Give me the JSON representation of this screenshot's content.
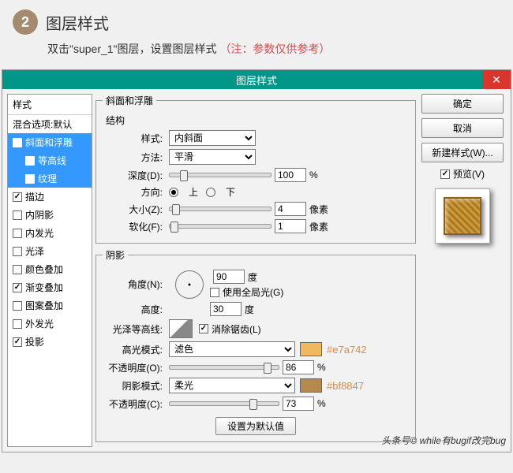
{
  "header": {
    "step": "2",
    "title": "图层样式",
    "desc_prefix": "双击\"super_1\"图层，设置图层样式",
    "note": "（注：参数仅供参考）"
  },
  "dialog": {
    "title": "图层样式"
  },
  "left": {
    "head": "样式",
    "blend": "混合选项:默认",
    "items": [
      {
        "label": "斜面和浮雕",
        "checked": true,
        "selected": true
      },
      {
        "label": "等高线",
        "checked": false,
        "sub": true,
        "selected": true
      },
      {
        "label": "纹理",
        "checked": true,
        "sub": true,
        "selected": true
      },
      {
        "label": "描边",
        "checked": true
      },
      {
        "label": "内阴影",
        "checked": false
      },
      {
        "label": "内发光",
        "checked": false
      },
      {
        "label": "光泽",
        "checked": false
      },
      {
        "label": "颜色叠加",
        "checked": false
      },
      {
        "label": "渐变叠加",
        "checked": true
      },
      {
        "label": "图案叠加",
        "checked": false
      },
      {
        "label": "外发光",
        "checked": false
      },
      {
        "label": "投影",
        "checked": true
      }
    ]
  },
  "bevel": {
    "group": "斜面和浮雕",
    "struct": "结构",
    "style_label": "样式:",
    "style_value": "内斜面",
    "tech_label": "方法:",
    "tech_value": "平滑",
    "depth_label": "深度(D):",
    "depth_value": "100",
    "pct": "%",
    "dir_label": "方向:",
    "up": "上",
    "down": "下",
    "size_label": "大小(Z):",
    "size_value": "4",
    "px": "像素",
    "soften_label": "软化(F):",
    "soften_value": "1"
  },
  "shade": {
    "group": "阴影",
    "angle_label": "角度(N):",
    "angle_value": "90",
    "deg": "度",
    "global": "使用全局光(G)",
    "alt_label": "高度:",
    "alt_value": "30",
    "gloss_label": "光泽等高线:",
    "aa": "消除锯齿(L)",
    "hi_label": "高光模式:",
    "hi_value": "滤色",
    "hi_hex": "#e7a742",
    "hi_color": "#f0b85f",
    "hi_op_label": "不透明度(O):",
    "hi_op_value": "86",
    "sh_label": "阴影模式:",
    "sh_value": "柔光",
    "sh_hex": "#bf8847",
    "sh_color": "#b5894e",
    "sh_op_label": "不透明度(C):",
    "sh_op_value": "73"
  },
  "buttons": {
    "ok": "确定",
    "cancel": "取消",
    "new": "新建样式(W)...",
    "preview": "预览(V)",
    "defaults": "设置为默认值"
  },
  "watermark": "头条号© while有bugif改完bug"
}
